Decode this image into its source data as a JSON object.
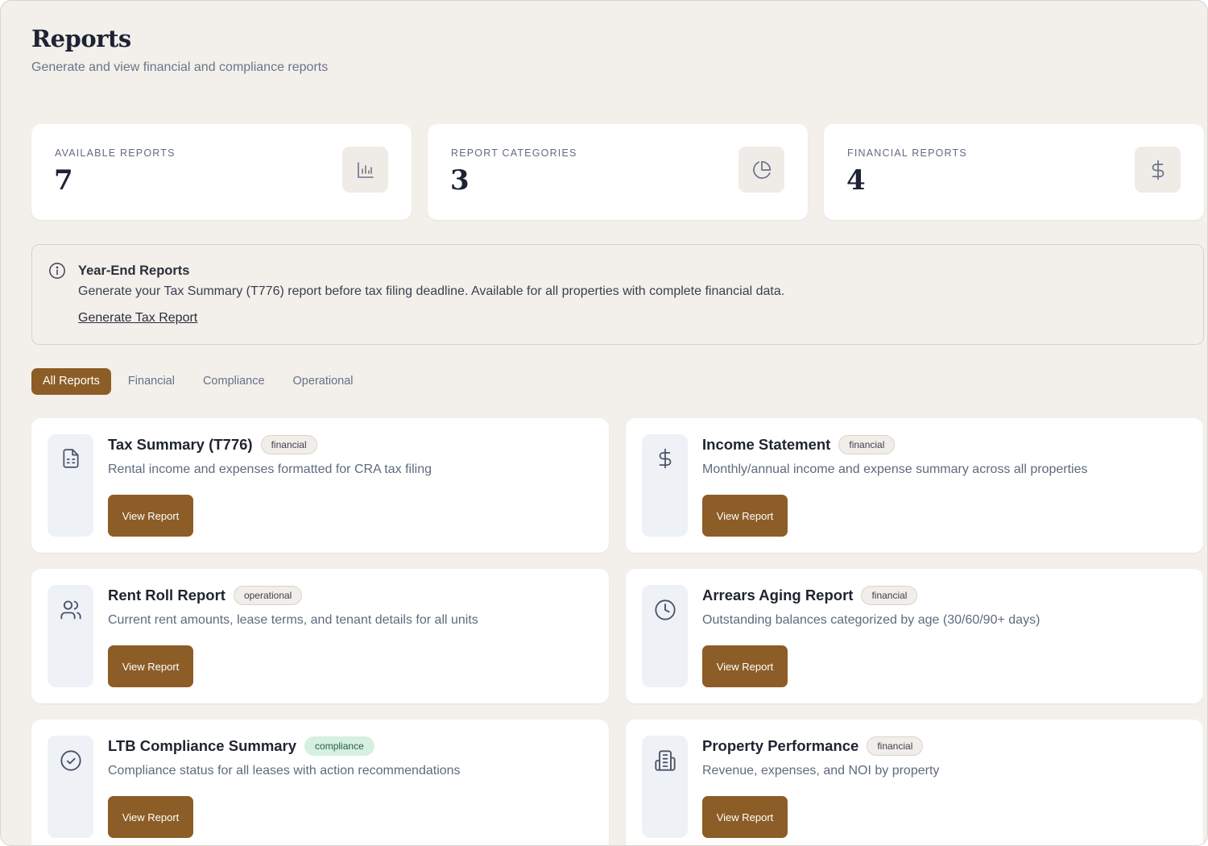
{
  "header": {
    "title": "Reports",
    "subtitle": "Generate and view financial and compliance reports"
  },
  "stats": [
    {
      "label": "AVAILABLE REPORTS",
      "value": "7",
      "icon": "bar-chart-icon"
    },
    {
      "label": "REPORT CATEGORIES",
      "value": "3",
      "icon": "pie-chart-icon"
    },
    {
      "label": "FINANCIAL REPORTS",
      "value": "4",
      "icon": "dollar-icon"
    }
  ],
  "notice": {
    "icon": "info-icon",
    "title": "Year-End Reports",
    "text": "Generate your Tax Summary (T776) report before tax filing deadline. Available for all properties with complete financial data.",
    "link": "Generate Tax Report"
  },
  "tabs": [
    {
      "label": "All Reports",
      "active": true
    },
    {
      "label": "Financial",
      "active": false
    },
    {
      "label": "Compliance",
      "active": false
    },
    {
      "label": "Operational",
      "active": false
    }
  ],
  "reports": [
    {
      "title": "Tax Summary (T776)",
      "badge": "financial",
      "description": "Rental income and expenses formatted for CRA tax filing",
      "button": "View Report",
      "icon": "document-icon"
    },
    {
      "title": "Income Statement",
      "badge": "financial",
      "description": "Monthly/annual income and expense summary across all properties",
      "button": "View Report",
      "icon": "dollar-icon"
    },
    {
      "title": "Rent Roll Report",
      "badge": "operational",
      "description": "Current rent amounts, lease terms, and tenant details for all units",
      "button": "View Report",
      "icon": "users-icon"
    },
    {
      "title": "Arrears Aging Report",
      "badge": "financial",
      "description": "Outstanding balances categorized by age (30/60/90+ days)",
      "button": "View Report",
      "icon": "clock-icon"
    },
    {
      "title": "LTB Compliance Summary",
      "badge": "compliance",
      "description": "Compliance status for all leases with action recommendations",
      "button": "View Report",
      "icon": "check-circle-icon"
    },
    {
      "title": "Property Performance",
      "badge": "financial",
      "description": "Revenue, expenses, and NOI by property",
      "button": "View Report",
      "icon": "building-icon"
    }
  ],
  "colors": {
    "accent": "#8c5d26",
    "background": "#f3f0eb",
    "compliance_badge": "#d5f0e0"
  }
}
